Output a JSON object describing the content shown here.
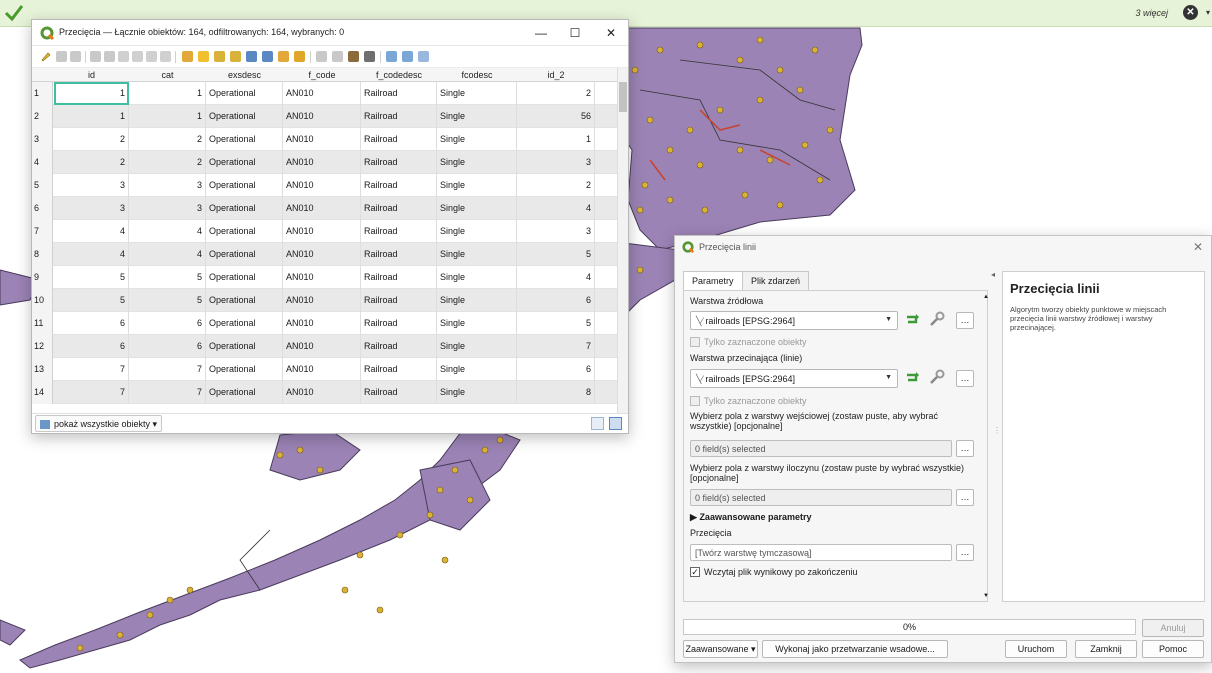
{
  "message_bar": {
    "more_label": "3 więcej"
  },
  "attr_table": {
    "title": "Przecięcia — Łącznie obiektów: 164, odfiltrowanych: 164, wybranych: 0",
    "columns": [
      "id",
      "cat",
      "exsdesc",
      "f_code",
      "f_codedesc",
      "fcodesc",
      "id_2"
    ],
    "rows": [
      [
        "1",
        "1",
        "1",
        "Operational",
        "AN010",
        "Railroad",
        "Single",
        "2"
      ],
      [
        "2",
        "1",
        "1",
        "Operational",
        "AN010",
        "Railroad",
        "Single",
        "56"
      ],
      [
        "3",
        "2",
        "2",
        "Operational",
        "AN010",
        "Railroad",
        "Single",
        "1"
      ],
      [
        "4",
        "2",
        "2",
        "Operational",
        "AN010",
        "Railroad",
        "Single",
        "3"
      ],
      [
        "5",
        "3",
        "3",
        "Operational",
        "AN010",
        "Railroad",
        "Single",
        "2"
      ],
      [
        "6",
        "3",
        "3",
        "Operational",
        "AN010",
        "Railroad",
        "Single",
        "4"
      ],
      [
        "7",
        "4",
        "4",
        "Operational",
        "AN010",
        "Railroad",
        "Single",
        "3"
      ],
      [
        "8",
        "4",
        "4",
        "Operational",
        "AN010",
        "Railroad",
        "Single",
        "5"
      ],
      [
        "9",
        "5",
        "5",
        "Operational",
        "AN010",
        "Railroad",
        "Single",
        "4"
      ],
      [
        "10",
        "5",
        "5",
        "Operational",
        "AN010",
        "Railroad",
        "Single",
        "6"
      ],
      [
        "11",
        "6",
        "6",
        "Operational",
        "AN010",
        "Railroad",
        "Single",
        "5"
      ],
      [
        "12",
        "6",
        "6",
        "Operational",
        "AN010",
        "Railroad",
        "Single",
        "7"
      ],
      [
        "13",
        "7",
        "7",
        "Operational",
        "AN010",
        "Railroad",
        "Single",
        "6"
      ],
      [
        "14",
        "7",
        "7",
        "Operational",
        "AN010",
        "Railroad",
        "Single",
        "8"
      ]
    ],
    "show_all_label": "pokaż wszystkie obiekty"
  },
  "dialog": {
    "title": "Przecięcia linii",
    "tabs": [
      "Parametry",
      "Plik zdarzeń"
    ],
    "source_layer_label": "Warstwa źródłowa",
    "source_layer_value": "railroads [EPSG:2964]",
    "selected_only_label": "Tylko zaznaczone obiekty",
    "intersect_layer_label": "Warstwa przecinająca (linie)",
    "intersect_layer_value": "railroads [EPSG:2964]",
    "selected_only_label2": "Tylko zaznaczone obiekty",
    "input_fields_label": "Wybierz pola z warstwy wejściowej (zostaw puste, aby wybrać wszystkie) [opcjonalne]",
    "input_fields_value": "0 field(s) selected",
    "overlay_fields_label": "Wybierz pola z warstwy iloczynu (zostaw puste by wybrać wszystkie) [opcjonalne]",
    "overlay_fields_value": "0 field(s) selected",
    "advanced_params_label": "Zaawansowane parametry",
    "output_label": "Przecięcia",
    "output_placeholder": "[Twórz warstwę tymczasową]",
    "open_output_label": "Wczytaj plik wynikowy po zakończeniu",
    "help_title": "Przecięcia linii",
    "help_text": "Algorytm tworzy obiekty punktowe w miejscach przecięcia linii warstwy źródłowej i warstwy przecinającej.",
    "progress_text": "0%",
    "cancel_label": "Anuluj",
    "advanced_button": "Zaawansowane",
    "batch_button": "Wykonaj jako przetwarzanie wsadowe...",
    "run_button": "Uruchom",
    "close_button": "Zamknij",
    "help_button": "Pomoc"
  },
  "colors": {
    "land": "#9b83b5",
    "points": "#d9b23a",
    "accent": "#3fbfa0",
    "qgis_green": "#589632"
  }
}
